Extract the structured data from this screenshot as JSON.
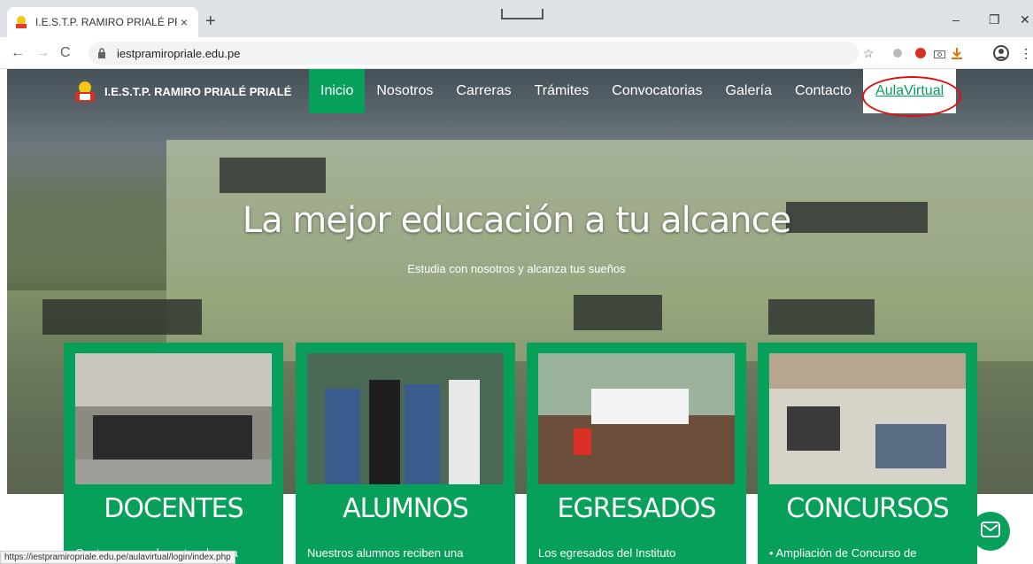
{
  "browser": {
    "tab_title": "I.E.S.T.P. RAMIRO PRIALÉ PRIALÉ",
    "tab_close": "×",
    "new_tab": "+",
    "url": "iestpramiropriale.edu.pe",
    "status_url": "https://iestpramiropriale.edu.pe/aulavirtual/login/index.php",
    "minimize": "–",
    "restore": "❐",
    "close": "✕"
  },
  "site": {
    "brand": "I.E.S.T.P. RAMIRO PRIALÉ PRIALÉ",
    "nav": [
      "Inicio",
      "Nosotros",
      "Carreras",
      "Trámites",
      "Convocatorias",
      "Galería",
      "Contacto",
      "AulaVirtual"
    ],
    "hero_title": "La mejor educación a tu alcance",
    "hero_subtitle": "Estudia con nosotros y alcanza tus sueños",
    "cards": [
      {
        "title": "DOCENTES",
        "text": "Contamos con docentes de una"
      },
      {
        "title": "ALUMNOS",
        "text": "Nuestros alumnos reciben una"
      },
      {
        "title": "EGRESADOS",
        "text": "Los egresados del Instituto"
      },
      {
        "title": "CONCURSOS",
        "text": "• Ampliación de Concurso de"
      }
    ]
  },
  "colors": {
    "accent": "#07a05a",
    "highlight_circle": "#e01010"
  }
}
